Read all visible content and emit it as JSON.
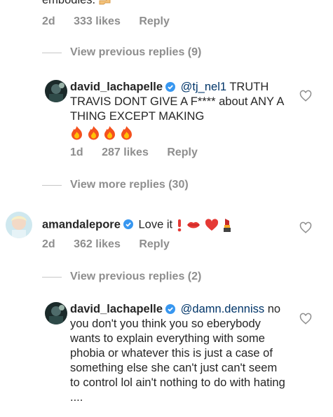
{
  "top": {
    "partial_text": "embodies.",
    "time": "2d",
    "likes": "333 likes",
    "reply": "Reply"
  },
  "thread1": {
    "view_label": "View previous replies (9)"
  },
  "comment1": {
    "username": "david_lachapelle",
    "mention": "@tj_nel1",
    "text": "TRUTH TRAVIS DONT GIVE A F**** about ANY A THING EXCEPT MAKING",
    "time": "1d",
    "likes": "287 likes",
    "reply": "Reply"
  },
  "thread2": {
    "view_label": "View more replies (30)"
  },
  "comment2": {
    "username": "amandalepore",
    "text": "Love it",
    "time": "2d",
    "likes": "362 likes",
    "reply": "Reply"
  },
  "thread3": {
    "view_label": "View previous replies (2)"
  },
  "comment3": {
    "username": "david_lachapelle",
    "mention": "@damn.denniss",
    "text": "no you don't you think you so eberybody wants to explain everything with some phobia or whatever this is just a case of something else she can't just can't seem to control lol ain't nothing to do with hating ...."
  },
  "colors": {
    "verified_blue": "#3897f0",
    "text": "#262626",
    "meta_grey": "#8e8e8e",
    "mention": "#003569"
  },
  "icons": [
    "verified-badge-icon",
    "heart-outline-icon",
    "fire-emoji-icon",
    "pointing-hand-emoji-icon",
    "exclamation-emoji-icon",
    "kiss-lips-emoji-icon",
    "red-heart-emoji-icon",
    "lipstick-emoji-icon"
  ]
}
